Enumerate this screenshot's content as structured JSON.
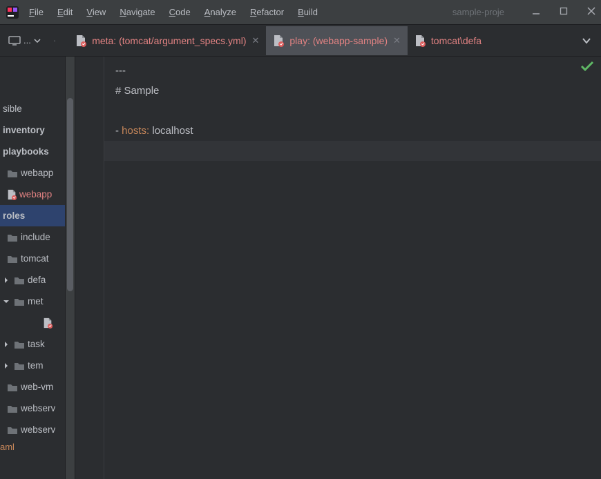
{
  "menubar": {
    "items": [
      {
        "label": "File",
        "mn": "F"
      },
      {
        "label": "Edit",
        "mn": "E"
      },
      {
        "label": "View",
        "mn": "V"
      },
      {
        "label": "Navigate",
        "mn": "N"
      },
      {
        "label": "Code",
        "mn": "C"
      },
      {
        "label": "Analyze",
        "mn": "A"
      },
      {
        "label": "Refactor",
        "mn": "R"
      },
      {
        "label": "Build",
        "mn": "B"
      }
    ]
  },
  "project_title": "sample-proje",
  "toolbar": {
    "dropdown_label": "..."
  },
  "tabs": {
    "items": [
      {
        "label": "meta: (tomcat/argument_specs.yml)",
        "active": false
      },
      {
        "label": "play: (webapp-sample)",
        "active": true
      },
      {
        "label": "tomcat\\defa",
        "active": false,
        "no_close": true
      }
    ]
  },
  "tree": {
    "items": [
      {
        "label": "sible",
        "indent": 0
      },
      {
        "label": "inventory",
        "indent": 0,
        "bold": true
      },
      {
        "label": "playbooks",
        "indent": 0,
        "bold": true
      },
      {
        "label": "webapp",
        "indent": 1,
        "icon": "folder"
      },
      {
        "label": "webapp",
        "indent": 1,
        "icon": "yaml",
        "color": "orange"
      },
      {
        "label": "roles",
        "indent": 0,
        "bold": true,
        "selected": true
      },
      {
        "label": "include",
        "indent": 1,
        "icon": "folder"
      },
      {
        "label": "tomcat",
        "indent": 1,
        "icon": "folder"
      },
      {
        "label": "defa",
        "indent": 2,
        "icon": "folder",
        "arrow": "right"
      },
      {
        "label": "met",
        "indent": 2,
        "icon": "folder",
        "arrow": "down"
      },
      {
        "label": "",
        "indent": 3,
        "icon": "yaml"
      },
      {
        "label": "task",
        "indent": 2,
        "icon": "folder",
        "arrow": "right"
      },
      {
        "label": "tem",
        "indent": 2,
        "icon": "folder",
        "arrow": "right"
      },
      {
        "label": "web-vm",
        "indent": 1,
        "icon": "folder"
      },
      {
        "label": "webserv",
        "indent": 1,
        "icon": "folder"
      },
      {
        "label": "webserv",
        "indent": 1,
        "icon": "folder"
      }
    ],
    "bottom_label": "aml"
  },
  "editor": {
    "lines": [
      {
        "raw": "---"
      },
      {
        "raw": "# Sample"
      },
      {
        "raw": ""
      },
      {
        "segments": [
          {
            "t": "- ",
            "c": "dash"
          },
          {
            "t": "hosts:",
            "c": "key"
          },
          {
            "t": " localhost",
            "c": "plain"
          }
        ]
      },
      {
        "raw": "",
        "current": true
      }
    ]
  }
}
